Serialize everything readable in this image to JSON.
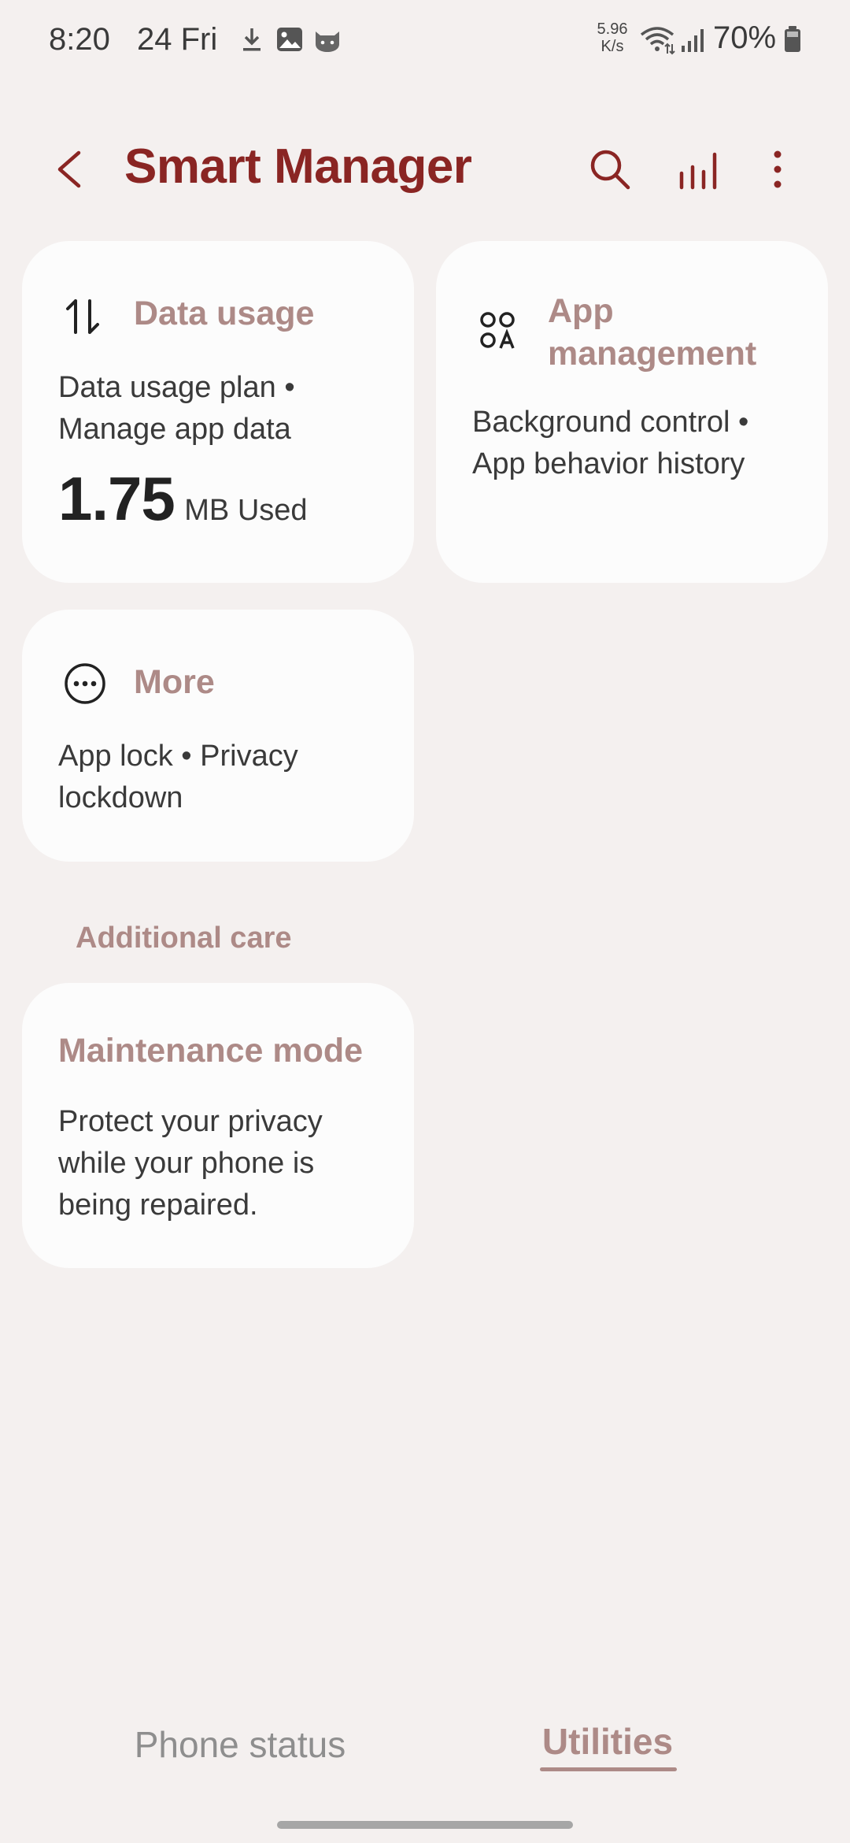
{
  "status_bar": {
    "time": "8:20",
    "date": "24 Fri",
    "net_speed_value": "5.96",
    "net_speed_unit": "K/s",
    "battery": "70%"
  },
  "app_bar": {
    "title": "Smart Manager",
    "icons": [
      "back-icon",
      "search-icon",
      "stats-icon",
      "more-vert-icon"
    ]
  },
  "cards": {
    "data_usage": {
      "title": "Data usage",
      "description": "Data usage plan •\nManage app data",
      "used_value": "1.75",
      "used_unit": "MB Used",
      "icon": "data-transfer-icon"
    },
    "app_management": {
      "title": "App\nmanagement",
      "description": "Background control •\nApp behavior history",
      "icon": "app-grid-icon"
    },
    "more": {
      "title": "More",
      "description": "App lock • Privacy\nlockdown",
      "icon": "more-circle-icon"
    }
  },
  "section": {
    "additional_care": "Additional care"
  },
  "maintenance": {
    "title": "Maintenance mode",
    "description": "Protect your privacy\nwhile your phone is\nbeing repaired."
  },
  "tabs": [
    {
      "label": "Phone status",
      "active": false
    },
    {
      "label": "Utilities",
      "active": true
    }
  ],
  "colors": {
    "background": "#f4f0ef",
    "title": "#8a2523",
    "accent": "#ad8a87",
    "card": "#fcfcfc"
  }
}
